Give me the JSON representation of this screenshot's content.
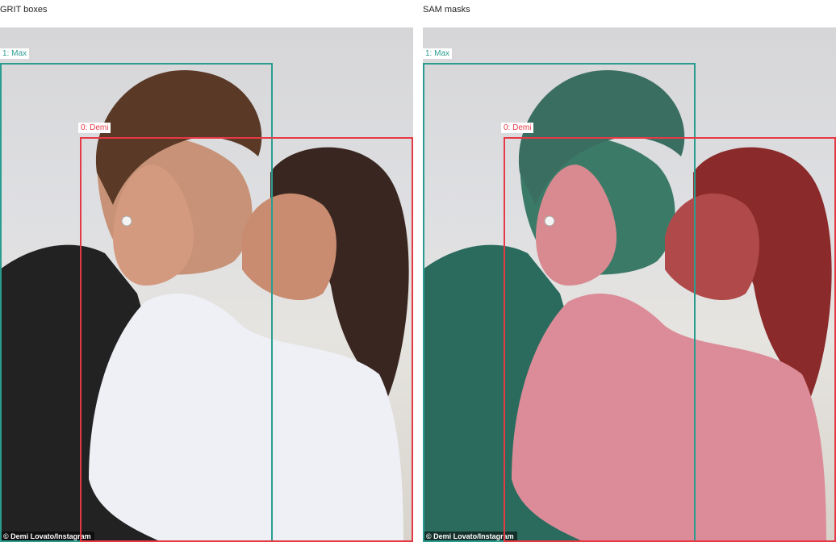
{
  "panels": {
    "left_title": "GRIT boxes",
    "right_title": "SAM masks"
  },
  "boxes": [
    {
      "label": "1: Max",
      "color": "#2a9d8f"
    },
    {
      "label": "0: Demi",
      "color": "#e63946"
    }
  ],
  "photo": {
    "credit": "© Demi Lovato/Instagram",
    "content": "two-people-kissing-photo"
  },
  "mask_colors": {
    "max": "#2a7a6b",
    "demi_body": "#d9707e",
    "demi_hair": "#9b2c2c"
  }
}
